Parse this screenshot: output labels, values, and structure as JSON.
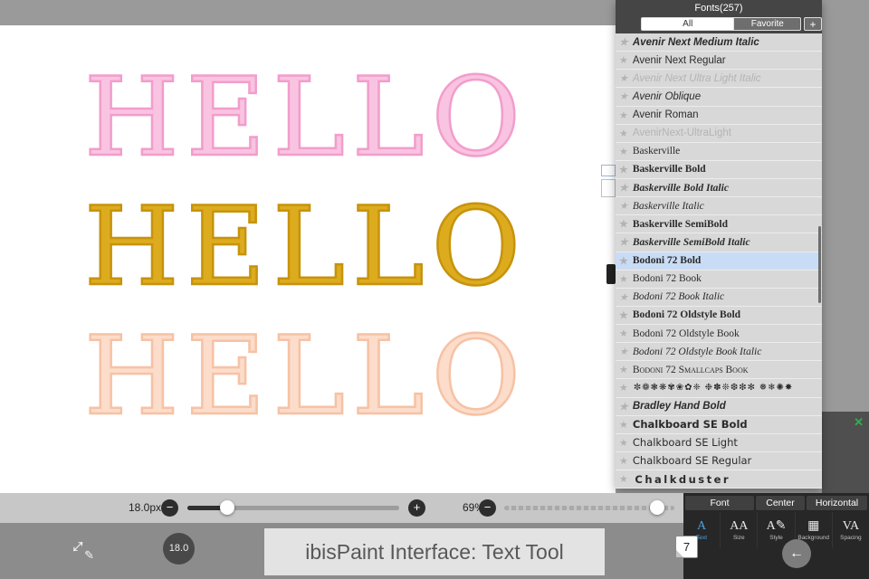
{
  "canvas": {
    "lines": [
      {
        "text": "HELLO",
        "fill": "#f9c4e1",
        "stroke": "#f29dcb"
      },
      {
        "text": "HELLO",
        "fill": "#ddab1e",
        "stroke": "#c6930c"
      },
      {
        "text": "HELLO",
        "fill": "#fcdcca",
        "stroke": "#f6c2a5"
      }
    ]
  },
  "font_panel": {
    "title": "Fonts(257)",
    "tab_all": "All",
    "tab_favorite": "Favorite",
    "tab_add": "+",
    "star_glyph": "★",
    "fonts": [
      {
        "name": "Avenir Next Medium Italic",
        "style": "sans italic medium"
      },
      {
        "name": "Avenir Next Regular",
        "style": "sans"
      },
      {
        "name": "Avenir Next Ultra Light Italic",
        "style": "sans italic dim"
      },
      {
        "name": "Avenir Oblique",
        "style": "sans italic"
      },
      {
        "name": "Avenir Roman",
        "style": "sans"
      },
      {
        "name": "AvenirNext-UltraLight",
        "style": "sans dim"
      },
      {
        "name": "Baskerville",
        "style": "serif"
      },
      {
        "name": "Baskerville Bold",
        "style": "serif bold"
      },
      {
        "name": "Baskerville Bold Italic",
        "style": "serif bold italic"
      },
      {
        "name": "Baskerville Italic",
        "style": "serif italic"
      },
      {
        "name": "Baskerville SemiBold",
        "style": "serif semibold"
      },
      {
        "name": "Baskerville SemiBold Italic",
        "style": "serif semibold italic"
      },
      {
        "name": "Bodoni 72 Bold",
        "style": "serif bold",
        "selected": true
      },
      {
        "name": "Bodoni 72 Book",
        "style": "serif"
      },
      {
        "name": "Bodoni 72 Book Italic",
        "style": "serif italic"
      },
      {
        "name": "Bodoni 72 Oldstyle Bold",
        "style": "serif bold"
      },
      {
        "name": "Bodoni 72 Oldstyle Book",
        "style": "serif"
      },
      {
        "name": "Bodoni 72 Oldstyle Book Italic",
        "style": "serif italic"
      },
      {
        "name": "Bodoni 72 Smallcaps Book",
        "style": "serif smallcaps"
      },
      {
        "name": "✼❁❃❋✾❀✿❈ ❉✽❊❆❇✻ ❅❄✺✸",
        "style": "ornament"
      },
      {
        "name": "Bradley Hand Bold",
        "style": "hand"
      },
      {
        "name": "Chalkboard SE Bold",
        "style": "chalk bold"
      },
      {
        "name": "Chalkboard SE Light",
        "style": "chalk"
      },
      {
        "name": "Chalkboard SE Regular",
        "style": "chalk"
      },
      {
        "name": "Chalkduster",
        "style": "chalk wide"
      }
    ]
  },
  "sliders": {
    "size_label": "18.0px",
    "zoom_label": "69%",
    "minus": "−",
    "plus": "+",
    "size_fill_pct": 19,
    "zoom_fill_pct": 90
  },
  "text_toolbar": {
    "font_button": "Font",
    "center_button": "Center",
    "horizontal_button": "Horizontal",
    "tools": [
      {
        "label": "Text",
        "glyph": "A",
        "active": true
      },
      {
        "label": "Size",
        "glyph": "AA"
      },
      {
        "label": "Style",
        "glyph": "A✎"
      },
      {
        "label": "Background",
        "glyph": "▦"
      },
      {
        "label": "Spacing",
        "glyph": "VA"
      }
    ]
  },
  "bottom_bar": {
    "size_badge": "18.0",
    "layer_count": "7",
    "caption": "ibisPaint Interface: Text Tool",
    "back_glyph": "←",
    "close_glyph": "✕",
    "transform_glyph": "↔",
    "pencil_glyph": "✎"
  }
}
